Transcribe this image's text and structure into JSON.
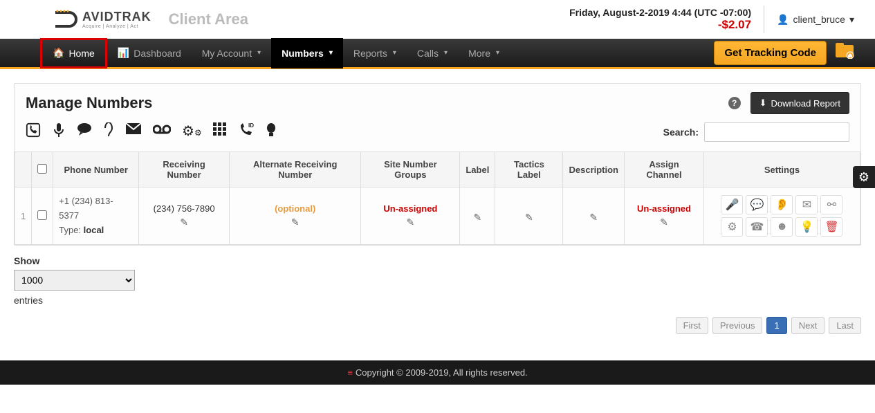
{
  "header": {
    "logo_text": "AVIDTRAK",
    "logo_sub": "Acquire | Analyze | Act",
    "client_area": "Client Area",
    "datetime": "Friday, August-2-2019 4:44 (UTC -07:00)",
    "balance": "-$2.07",
    "user": "client_bruce"
  },
  "nav": {
    "home": "Home",
    "dashboard": "Dashboard",
    "my_account": "My Account",
    "numbers": "Numbers",
    "reports": "Reports",
    "calls": "Calls",
    "more": "More",
    "tracking_btn": "Get Tracking Code"
  },
  "page": {
    "title": "Manage Numbers",
    "download": "Download Report",
    "search_label": "Search:"
  },
  "table": {
    "headers": {
      "phone": "Phone Number",
      "receiving": "Receiving Number",
      "alt_receiving": "Alternate Receiving Number",
      "site_groups": "Site Number Groups",
      "label": "Label",
      "tactics": "Tactics Label",
      "description": "Description",
      "channel": "Assign Channel",
      "settings": "Settings"
    },
    "rows": [
      {
        "idx": "1",
        "phone": "+1 (234) 813-5377",
        "type_label": "Type:",
        "type_value": "local",
        "receiving": "(234) 756-7890",
        "alt_receiving": "(optional)",
        "site_groups": "Un-assigned",
        "channel": "Un-assigned"
      }
    ]
  },
  "show": {
    "label": "Show",
    "value": "1000",
    "entries": "entries"
  },
  "pagination": {
    "first": "First",
    "previous": "Previous",
    "page": "1",
    "next": "Next",
    "last": "Last"
  },
  "footer": "Copyright © 2009-2019, All rights reserved."
}
